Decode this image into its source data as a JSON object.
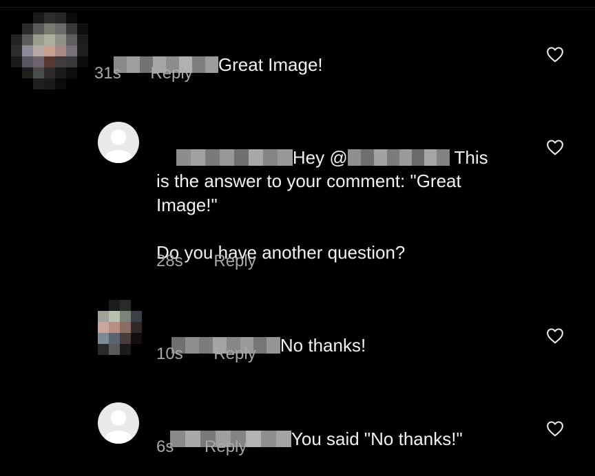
{
  "colors": {
    "background": "#000000",
    "text": "#f2f2f2",
    "meta": "#a8a8a8",
    "heart_outline": "#ececec"
  },
  "icons": {
    "like": "heart-outline-icon",
    "default_avatar": "default-user-avatar-icon"
  },
  "comments": [
    {
      "text": "Great Image!",
      "time": "31s",
      "reply_label": "Reply"
    },
    {
      "prefix": "Hey @",
      "text_after_mention": " This",
      "body_rest": "is the answer to your comment: \"Great Image!\"",
      "question": "Do you have another question?",
      "time": "28s",
      "reply_label": "Reply"
    },
    {
      "text": "No thanks!",
      "time": "10s",
      "reply_label": "Reply"
    },
    {
      "text": "You said \"No thanks!\"",
      "time": "6s",
      "reply_label": "Reply"
    }
  ]
}
